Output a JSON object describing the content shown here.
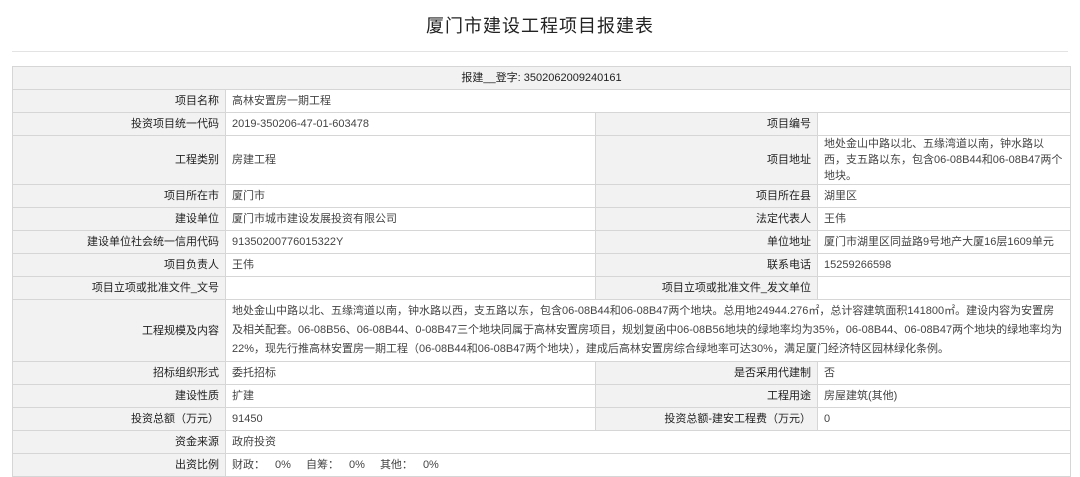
{
  "page": {
    "title": "厦门市建设工程项目报建表"
  },
  "header": {
    "text": "报建__登字: 3502062009240161"
  },
  "rows": {
    "project_name": {
      "label": "项目名称",
      "value": "高林安置房一期工程"
    },
    "invest_code": {
      "label": "投资项目统一代码",
      "value": "2019-350206-47-01-603478"
    },
    "project_no": {
      "label": "项目编号",
      "value": ""
    },
    "category": {
      "label": "工程类别",
      "value": "房建工程"
    },
    "address": {
      "label": "项目地址",
      "value": "地处金山中路以北、五缘湾道以南，钟水路以西，支五路以东，包含06-08B44和06-08B47两个地块。"
    },
    "city": {
      "label": "项目所在市",
      "value": "厦门市"
    },
    "county": {
      "label": "项目所在县",
      "value": "湖里区"
    },
    "builder": {
      "label": "建设单位",
      "value": "厦门市城市建设发展投资有限公司"
    },
    "legal_rep": {
      "label": "法定代表人",
      "value": "王伟"
    },
    "credit_code": {
      "label": "建设单位社会统一信用代码",
      "value": "91350200776015322Y"
    },
    "unit_address": {
      "label": "单位地址",
      "value": "厦门市湖里区同益路9号地产大厦16层1609单元"
    },
    "manager": {
      "label": "项目负责人",
      "value": "王伟"
    },
    "phone": {
      "label": "联系电话",
      "value": "15259266598"
    },
    "approval_doc_no": {
      "label": "项目立项或批准文件_文号",
      "value": ""
    },
    "approval_doc_unit": {
      "label": "项目立项或批准文件_发文单位",
      "value": ""
    },
    "scale": {
      "label": "工程规模及内容",
      "value": "地处金山中路以北、五缘湾道以南，钟水路以西，支五路以东，包含06-08B44和06-08B47两个地块。总用地24944.276㎡，总计容建筑面积141800㎡。建设内容为安置房及相关配套。06-08B56、06-08B44、0-08B47三个地块同属于高林安置房项目，规划复函中06-08B56地块的绿地率均为35%，06-08B44、06-08B47两个地块的绿地率均为22%，现先行推高林安置房一期工程（06-08B44和06-08B47两个地块），建成后高林安置房综合绿地率可达30%，满足厦门经济特区园林绿化条例。"
    },
    "bid_form": {
      "label": "招标组织形式",
      "value": "委托招标"
    },
    "agent_system": {
      "label": "是否采用代建制",
      "value": "否"
    },
    "nature": {
      "label": "建设性质",
      "value": "扩建"
    },
    "usage": {
      "label": "工程用途",
      "value": "房屋建筑(其他)"
    },
    "total_invest": {
      "label": "投资总额（万元）",
      "value": "91450"
    },
    "install_fee": {
      "label": "投资总额-建安工程费（万元）",
      "value": "0"
    },
    "fund_source": {
      "label": "资金来源",
      "value": "政府投资"
    },
    "contribution": {
      "label": "出资比例",
      "items": [
        {
          "name": "财政：",
          "value": "0%"
        },
        {
          "name": "自筹：",
          "value": "0%"
        },
        {
          "name": "其他：",
          "value": "0%"
        }
      ]
    }
  }
}
